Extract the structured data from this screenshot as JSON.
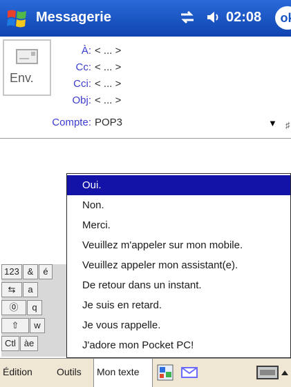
{
  "titlebar": {
    "app_title": "Messagerie",
    "time": "02:08",
    "ok_label": "ok"
  },
  "header": {
    "send_label": "Env.",
    "fields": [
      {
        "label": "À:",
        "value": "< ... >"
      },
      {
        "label": "Cc:",
        "value": "< ... >"
      },
      {
        "label": "Cci:",
        "value": "< ... >"
      },
      {
        "label": "Obj:",
        "value": "< ... >"
      }
    ],
    "account": {
      "label": "Compte:",
      "value": "POP3"
    },
    "edge_glyph": "♯"
  },
  "quick_text": {
    "selected_index": 0,
    "items": [
      "Oui.",
      "Non.",
      "Merci.",
      "Veuillez m'appeler sur mon mobile.",
      "Veuillez appeler mon assistant(e).",
      "De retour dans un instant.",
      "Je suis en retard.",
      "Je vous rappelle.",
      "J'adore mon Pocket PC!"
    ]
  },
  "keyboard": {
    "row1": [
      "123",
      "&",
      "é"
    ],
    "row2": [
      "⇆",
      "a"
    ],
    "row3": [
      "⓪",
      "q"
    ],
    "row4": [
      "⇧",
      "w"
    ],
    "row5": [
      "Ctl",
      "àe"
    ]
  },
  "menubar": {
    "edit": "Édition",
    "tools": "Outils",
    "my_text": "Mon texte"
  },
  "colors": {
    "titlebar": "#1552c4",
    "field_label": "#3b3bd1",
    "selection": "#1313a8",
    "menubar": "#efe6d4"
  }
}
